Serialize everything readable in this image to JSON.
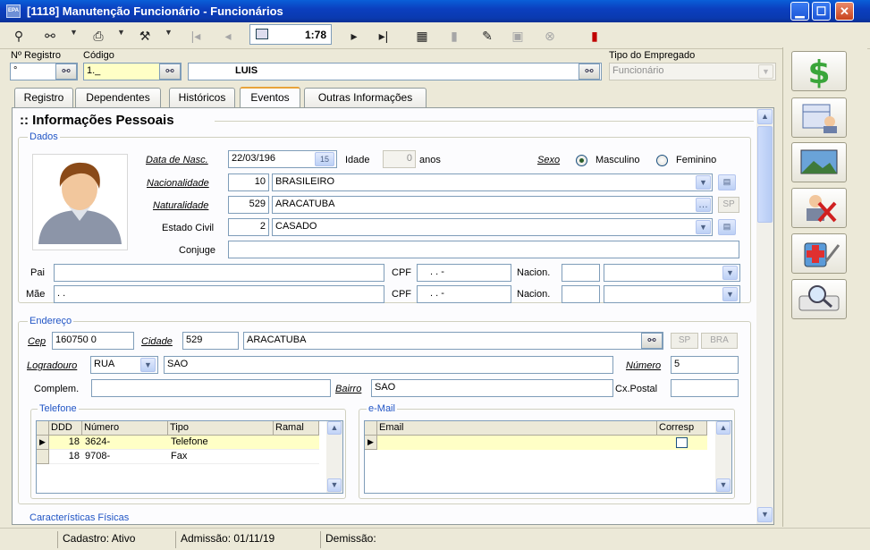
{
  "window": {
    "title": "[1118] Manutenção Funcionário - Funcionários",
    "app_icon": "app-icon"
  },
  "toolbar": {
    "record_position": "1:78"
  },
  "header": {
    "registro_label": "Nº Registro",
    "registro_value": "°",
    "codigo_label": "Código",
    "codigo_value": "1._",
    "nome_value": "LUIS",
    "tipo_label": "Tipo do Empregado",
    "tipo_value": "Funcionário"
  },
  "tabs": [
    {
      "label": "Registro"
    },
    {
      "label": "Dependentes"
    },
    {
      "label": "Históricos"
    },
    {
      "label": "Eventos"
    },
    {
      "label": "Outras Informações"
    }
  ],
  "pessoais": {
    "section_title": ":: Informações Pessoais",
    "dados_title": "Dados",
    "data_nasc_label": "Data de Nasc.",
    "data_nasc_value": "22/03/196",
    "idade_label": "Idade",
    "idade_value": "0",
    "anos_label": "anos",
    "sexo_label": "Sexo",
    "sexo_masculino": "Masculino",
    "sexo_feminino": "Feminino",
    "nacionalidade_label": "Nacionalidade",
    "nacionalidade_code": "10",
    "nacionalidade_value": "BRASILEIRO",
    "naturalidade_label": "Naturalidade",
    "naturalidade_code": "529",
    "naturalidade_value": "ARACATUBA",
    "naturalidade_uf": "SP",
    "estado_civil_label": "Estado Civil",
    "estado_civil_code": "2",
    "estado_civil_value": "CASADO",
    "conjuge_label": "Conjuge",
    "pai_label": "Pai",
    "mae_label": "Mãe",
    "mae_value": ".                         .",
    "cpf_label": "CPF",
    "cpf_mask": ".    .    -",
    "nacion_label": "Nacion."
  },
  "endereco": {
    "title": "Endereço",
    "cep_label": "Cep",
    "cep_value": "160750  0",
    "cidade_label": "Cidade",
    "cidade_code": "529",
    "cidade_value": "ARACATUBA",
    "uf_value": "SP",
    "pais_value": "BRA",
    "logradouro_label": "Logradouro",
    "logradouro_tipo": "RUA",
    "logradouro_value": "SAO",
    "numero_label": "Número",
    "numero_value": "5",
    "complemento_label": "Complem.",
    "bairro_label": "Bairro",
    "bairro_value": "SAO",
    "cxpostal_label": "Cx.Postal"
  },
  "telefone": {
    "title": "Telefone",
    "columns": [
      "DDD",
      "Número",
      "Tipo",
      "Ramal"
    ],
    "rows": [
      {
        "ddd": "18",
        "numero": "3624-",
        "tipo": "Telefone",
        "ramal": ""
      },
      {
        "ddd": "18",
        "numero": "9708-",
        "tipo": "Fax",
        "ramal": ""
      }
    ]
  },
  "email": {
    "title": "e-Mail",
    "columns": [
      "Email",
      "Corresp"
    ]
  },
  "fisicas": {
    "title": "Características Físicas"
  },
  "status": {
    "cadastro": "Cadastro: Ativo",
    "admissao": "Admissão: 01/11/19",
    "demissao": "Demissão:"
  },
  "colors": {
    "titlebar": "#0A3AB0",
    "group_title": "#2155c5",
    "row_selected": "#ffffc6",
    "active_tab_accent": "#e8a33a"
  }
}
